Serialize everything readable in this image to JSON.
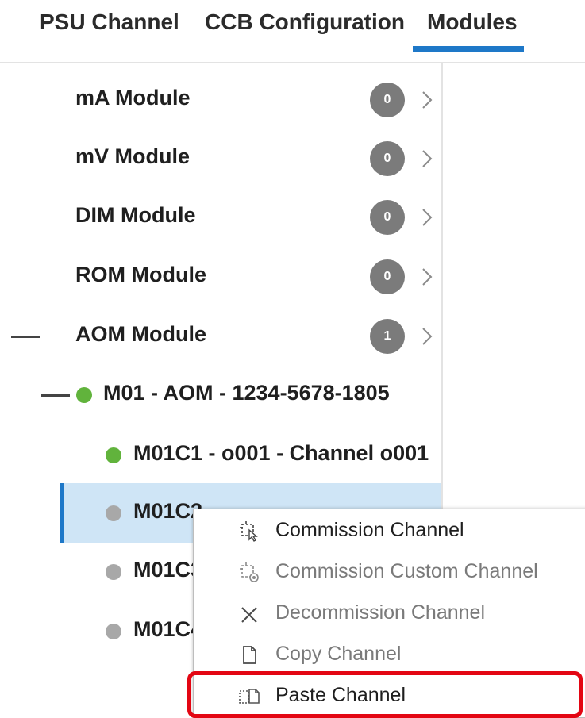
{
  "tabs": {
    "psu_channel": "PSU Channel",
    "ccb_configuration": "CCB Configuration",
    "modules": "Modules",
    "active": "Modules"
  },
  "modules": [
    {
      "name": "mA Module",
      "count": "0"
    },
    {
      "name": "mV Module",
      "count": "0"
    },
    {
      "name": "DIM Module",
      "count": "0"
    },
    {
      "name": "ROM Module",
      "count": "0"
    },
    {
      "name": "AOM Module",
      "count": "1"
    }
  ],
  "tree": {
    "module_instance": {
      "label": "M01 - AOM - 1234-5678-1805",
      "status": "green"
    },
    "channels": [
      {
        "label": "M01C1 - o001 - Channel o001",
        "status": "green"
      },
      {
        "label": "M01C2",
        "status": "gray",
        "selected": true
      },
      {
        "label": "M01C3",
        "status": "gray"
      },
      {
        "label": "M01C4",
        "status": "gray"
      }
    ]
  },
  "context_menu": {
    "items": [
      {
        "label": "Commission Channel",
        "icon": "commission-icon",
        "enabled": true
      },
      {
        "label": "Commission Custom Channel",
        "icon": "commission-custom-icon",
        "enabled": false
      },
      {
        "label": "Decommission Channel",
        "icon": "close-icon",
        "enabled": false
      },
      {
        "label": "Copy Channel",
        "icon": "copy-icon",
        "enabled": false
      },
      {
        "label": "Paste Channel",
        "icon": "paste-icon",
        "enabled": true,
        "highlighted": true
      }
    ]
  },
  "colors": {
    "accent": "#1e78c8",
    "selected_bg": "#cfe5f6",
    "status_green": "#61b33c",
    "status_gray": "#a8a8a8",
    "badge": "#7b7b7b",
    "highlight": "#e30613"
  }
}
